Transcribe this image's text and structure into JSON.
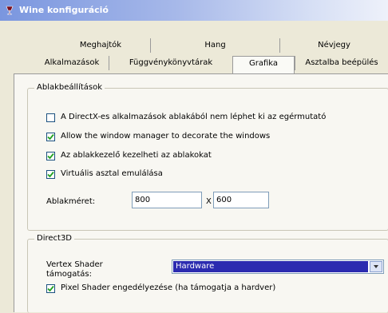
{
  "window": {
    "title": "Wine konfiguráció"
  },
  "tabs": {
    "row1": [
      "Meghajtók",
      "Hang",
      "Névjegy"
    ],
    "row2": [
      "Alkalmazások",
      "Függvénykönyvtárak",
      "Grafika",
      "Asztalba beépülés"
    ],
    "active": "Grafika"
  },
  "window_settings": {
    "legend": "Ablakbeállítások",
    "options": [
      {
        "label": "A DirectX-es alkalmazások ablakából nem léphet ki az egérmutató",
        "checked": false
      },
      {
        "label": "Allow the window manager to decorate the windows",
        "checked": true
      },
      {
        "label": "Az ablakkezelő kezelheti az ablakokat",
        "checked": true
      },
      {
        "label": "Virtuális asztal emulálása",
        "checked": true
      }
    ],
    "size_label": "Ablakméret:",
    "width": "800",
    "x_label": "X",
    "height": "600"
  },
  "direct3d": {
    "legend": "Direct3D",
    "vertex_shader_label": "Vertex Shader támogatás:",
    "vertex_shader_value": "Hardware",
    "pixel_shader_label": "Pixel Shader engedélyezése (ha támogatja a hardver)",
    "pixel_shader_checked": true
  }
}
